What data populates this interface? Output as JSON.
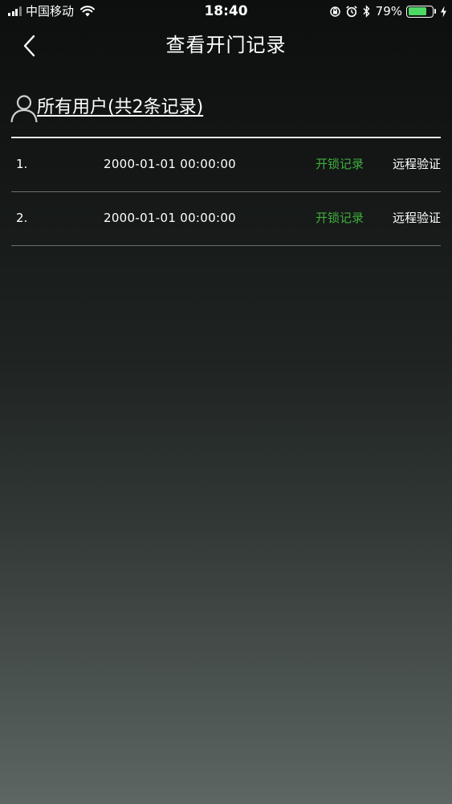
{
  "status_bar": {
    "carrier": "中国移动",
    "time": "18:40",
    "battery_percent": "79%",
    "battery_level": 0.79,
    "icons": [
      "signal-icon",
      "wifi-icon",
      "orientation-lock-icon",
      "alarm-icon",
      "bluetooth-icon",
      "battery-icon",
      "charging-icon"
    ],
    "battery_color": "#4cd964"
  },
  "nav": {
    "back_icon": "chevron-left-icon",
    "title": "查看开门记录"
  },
  "filter": {
    "icon": "user-icon",
    "label": "所有用户(共2条记录)"
  },
  "records": [
    {
      "index": "1.",
      "time": "2000-01-01 00:00:00",
      "type": "开锁记录",
      "method": "远程验证"
    },
    {
      "index": "2.",
      "time": "2000-01-01 00:00:00",
      "type": "开锁记录",
      "method": "远程验证"
    }
  ],
  "colors": {
    "accent_green": "#3fae3c",
    "text": "#ffffff"
  }
}
